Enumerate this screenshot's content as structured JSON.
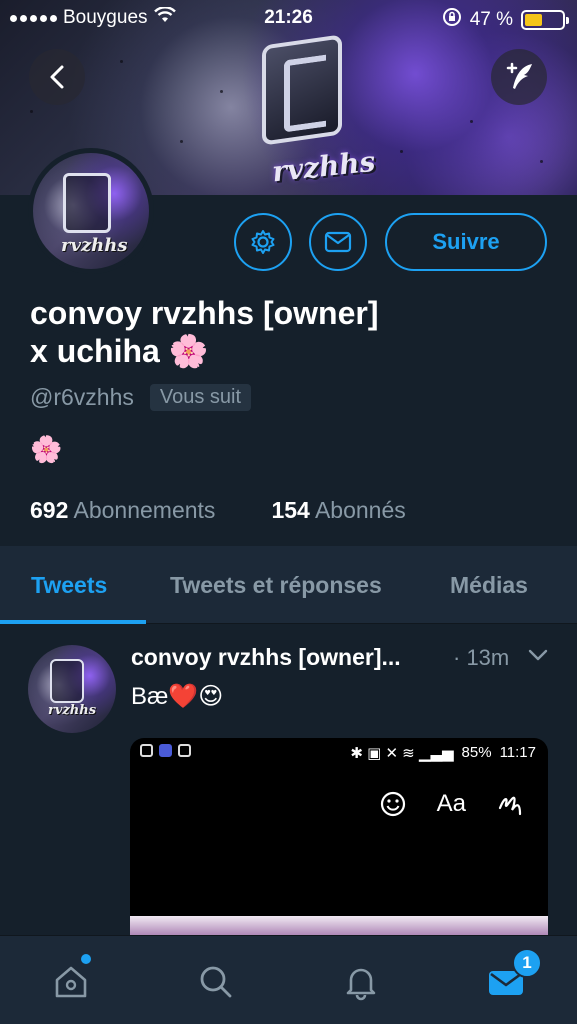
{
  "status_bar": {
    "carrier": "Bouygues",
    "time": "21:26",
    "battery_percent": "47 %",
    "battery_level": 0.47
  },
  "banner": {
    "logo_text": "rvzhhs"
  },
  "profile": {
    "display_name_line1": "convoy rvzhhs [owner]",
    "display_name_line2": "x uchiha 🌸",
    "handle": "@r6vzhhs",
    "follows_you_badge": "Vous suit",
    "bio": "🌸",
    "following_count": "692",
    "following_label": "Abonnements",
    "followers_count": "154",
    "followers_label": "Abonnés",
    "follow_button": "Suivre"
  },
  "tabs": [
    {
      "label": "Tweets",
      "active": true
    },
    {
      "label": "Tweets et réponses",
      "active": false
    },
    {
      "label": "Médias",
      "active": false
    }
  ],
  "tweet": {
    "author": "convoy rvzhhs [owner]...",
    "time": "· 13m",
    "text": "Bæ❤️😍",
    "media": {
      "status_battery": "85%",
      "status_time": "11:17",
      "text_tool": "Aa"
    }
  },
  "bottom_nav": {
    "messages_badge": "1"
  },
  "colors": {
    "background": "#15202b",
    "accent": "#1da1f2",
    "secondary_text": "#8899a6",
    "panel": "#1c2938"
  }
}
